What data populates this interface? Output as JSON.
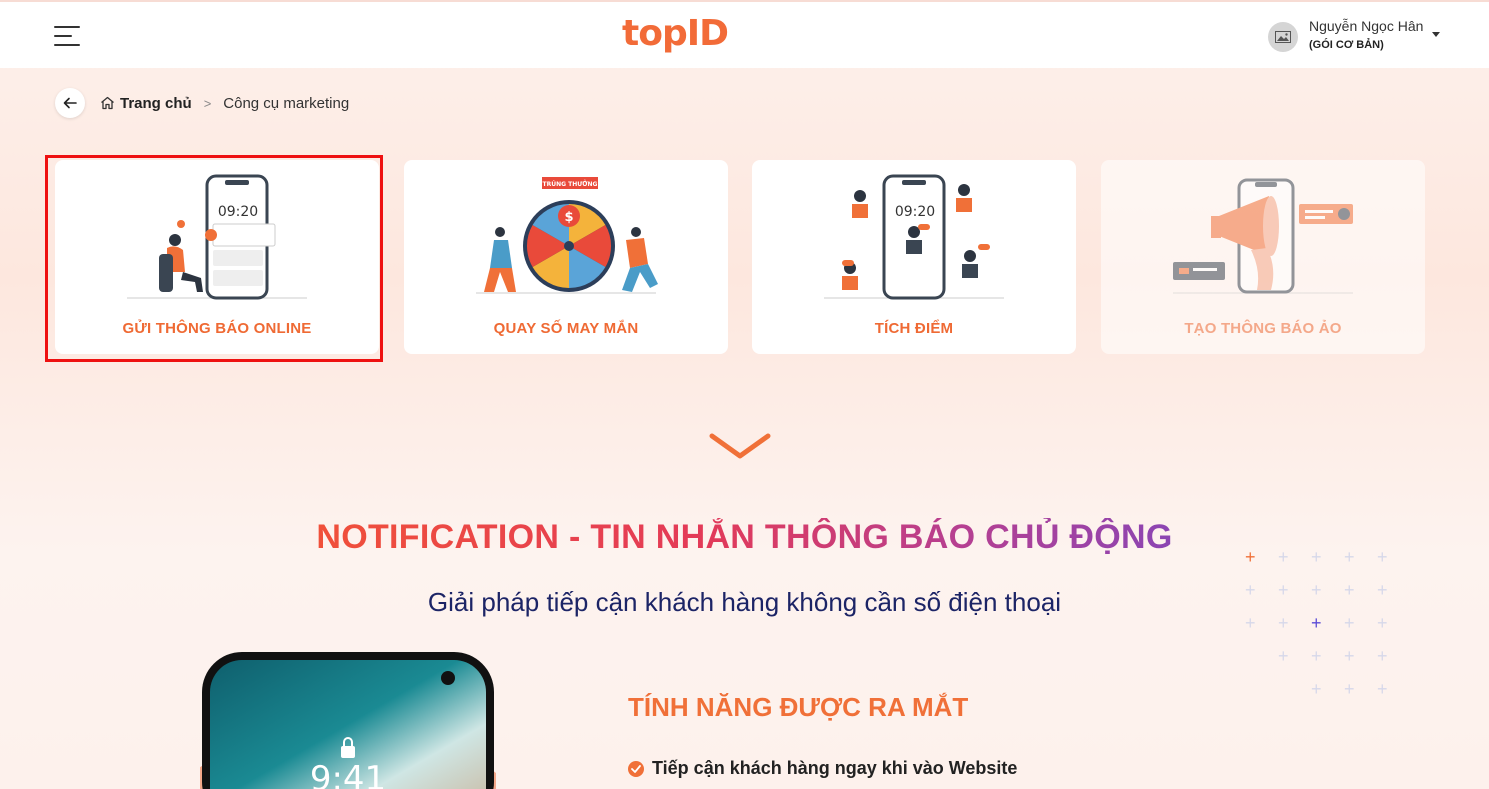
{
  "header": {
    "logo_text": "topID",
    "user": {
      "name": "Nguyễn Ngọc Hân",
      "plan": "(GÓI CƠ BẢN)"
    }
  },
  "breadcrumb": {
    "home_label": "Trang chủ",
    "separator": ">",
    "current": "Công cụ marketing"
  },
  "cards": [
    {
      "label": "GỬI THÔNG BÁO ONLINE",
      "illustration_time": "09:20",
      "selected": true
    },
    {
      "label": "QUAY SỐ MAY MẮN",
      "illustration_banner": "TRÚNG THƯỞNG"
    },
    {
      "label": "TÍCH ĐIỂM",
      "illustration_time": "09:20"
    },
    {
      "label": "TẠO THÔNG BÁO ẢO",
      "disabled": true
    }
  ],
  "section": {
    "title": "NOTIFICATION - TIN NHẮN THÔNG BÁO CHỦ ĐỘNG",
    "subtitle": "Giải pháp tiếp cận khách hàng không cần số điện thoại",
    "feature_title": "TÍNH NĂNG ĐƯỢC RA MẮT",
    "features": [
      "Tiếp cận khách hàng ngay khi vào Website"
    ],
    "phone_time": "9:41"
  },
  "colors": {
    "brand": "#f26b38",
    "highlight_border": "#ee1111",
    "subtitle": "#1c2466"
  }
}
